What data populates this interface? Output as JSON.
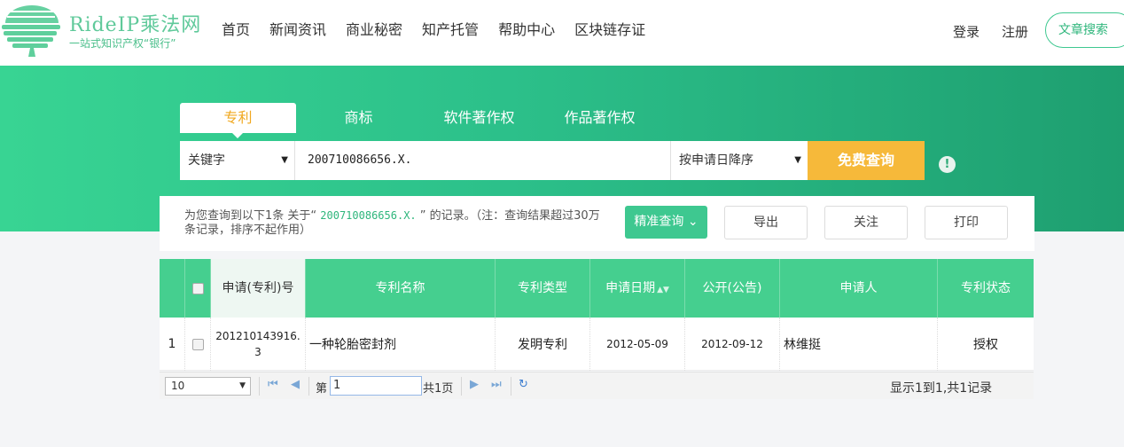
{
  "header": {
    "brand": "RideIP乘法网",
    "tagline": "一站式知识产权“银行”",
    "nav": [
      "首页",
      "新闻资讯",
      "商业秘密",
      "知产托管",
      "帮助中心",
      "区块链存证"
    ],
    "login": "登录",
    "register": "注册",
    "article_search": "文章搜索"
  },
  "tabs": [
    "专利",
    "商标",
    "软件著作权",
    "作品著作权"
  ],
  "search": {
    "field": "关键字",
    "query": "200710086656.X.",
    "sort": "按申请日降序",
    "submit": "免费查询",
    "info_icon": "!"
  },
  "result": {
    "prefix": "为您查询到以下1条 关于“ ",
    "keyword": "200710086656.X.",
    "suffix": " ” 的记录。（注：查询结果超过30万条记录，排序不起作用）",
    "precise_btn": "精准查询",
    "export_btn": "导出",
    "follow_btn": "关注",
    "print_btn": "打印"
  },
  "table": {
    "headers": [
      "申请(专利)号",
      "专利名称",
      "专利类型",
      "申请日期",
      "公开(公告)",
      "申请人",
      "专利状态"
    ],
    "sort_icon": "▲▼",
    "rows": [
      {
        "index": "1",
        "number": "201210143916.3",
        "name": "一种轮胎密封剂",
        "type": "发明专利",
        "apply_date": "2012-05-09",
        "pub_date": "2012-09-12",
        "applicant": "林维挺",
        "status": "授权"
      }
    ]
  },
  "pager": {
    "page_size": "10",
    "page_label_pre": "第",
    "page_value": "1",
    "page_label_post": "共1页",
    "display": "显示1到1,共1记录"
  },
  "colors": {
    "accent": "#3ec890",
    "banner_dark": "#1e9f70",
    "button_gold": "#f6b93a",
    "tab_active_text": "#f0a820"
  }
}
